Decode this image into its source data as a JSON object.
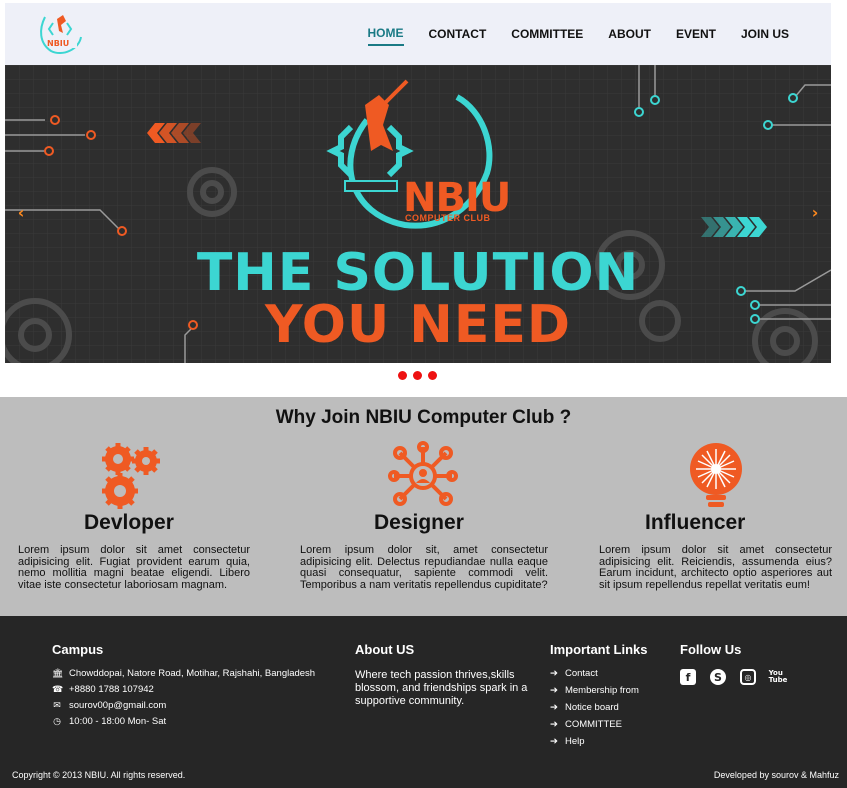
{
  "nav": {
    "items": [
      "HOME",
      "CONTACT",
      "COMMITTEE",
      "ABOUT",
      "EVENT",
      "JOIN US"
    ],
    "active": "HOME"
  },
  "logo": {
    "text": "NBIU",
    "sub": "COMPUTER CLUB"
  },
  "hero": {
    "brand": "NBIU",
    "brand_sub": "COMPUTER CLUB",
    "headline_1": "THE SOLUTION",
    "headline_2": "YOU NEED",
    "prev_icon": "chevron-left-icon",
    "next_icon": "chevron-right-icon",
    "slide_count": 3,
    "active_slide": 1
  },
  "why": {
    "title": "Why Join NBIU Computer Club ?",
    "cards": [
      {
        "icon": "gears-icon",
        "title": "Devloper",
        "text": "Lorem ipsum dolor sit amet consectetur adipisicing elit. Fugiat provident earum quia, nemo mollitia magni beatae eligendi. Libero vitae iste consectetur laboriosam magnam."
      },
      {
        "icon": "network-icon",
        "title": "Designer",
        "text": "Lorem ipsum dolor sit, amet consectetur adipisicing elit. Delectus repudiandae nulla eaque quasi consequatur, sapiente commodi velit. Temporibus a nam veritatis repellendus cupiditate?"
      },
      {
        "icon": "lightbulb-icon",
        "title": "Influencer",
        "text": "Lorem ipsum dolor sit amet consectetur adipisicing elit. Reiciendis, assumenda eius? Earum incidunt, architecto optio asperiores aut sit ipsum repellendus repellat veritatis eum!"
      }
    ]
  },
  "footer": {
    "campus": {
      "title": "Campus",
      "address": "Chowddopai, Natore Road, Motihar, Rajshahi, Bangladesh",
      "phone": "+8880 1788 107942",
      "email": "sourov00p@gmail.com",
      "hours": "10:00 - 18:00 Mon- Sat"
    },
    "about": {
      "title": "About US",
      "text": "Where tech passion thrives,skills blossom, and friendships spark in a supportive community."
    },
    "links": {
      "title": "Important Links",
      "items": [
        "Contact",
        "Membership from",
        "Notice board",
        "COMMITTEE",
        "Help"
      ]
    },
    "follow": {
      "title": "Follow Us",
      "icons": [
        "facebook-icon",
        "skype-icon",
        "instagram-icon",
        "youtube-icon"
      ]
    },
    "copyright": "Copyright © 2013 NBIU. All rights reserved.",
    "developed": "Developed by sourov & Mahfuz"
  },
  "colors": {
    "accent_teal": "#3cd6d2",
    "accent_orange": "#ef5a23",
    "dot_red": "#e11111",
    "footer_bg": "#262626",
    "section_bg": "#bdbdbd"
  }
}
